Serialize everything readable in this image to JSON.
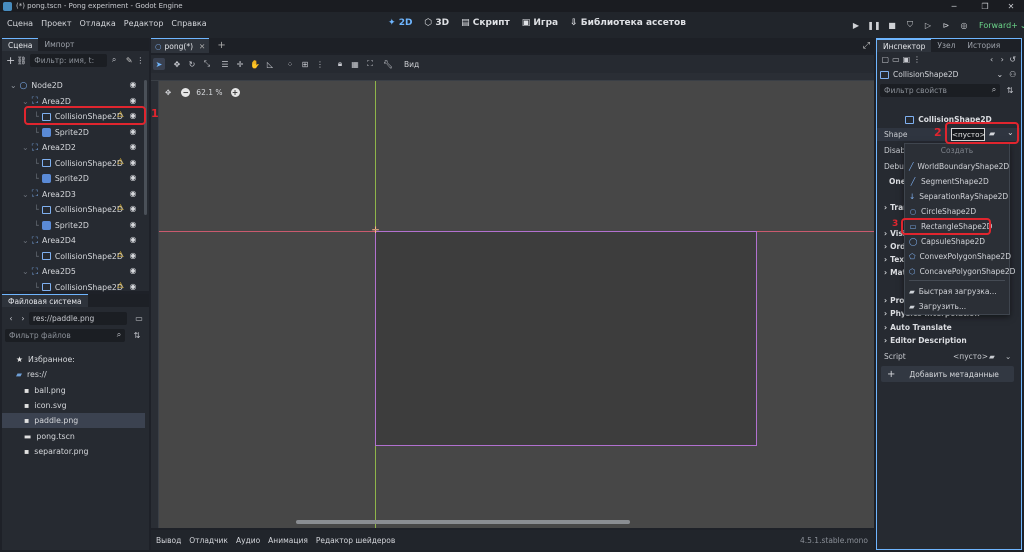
{
  "window": {
    "title": "(*) pong.tscn - Pong experiment - Godot Engine",
    "min": "─",
    "max": "❐",
    "close": "✕"
  },
  "menu": {
    "items": [
      "Сцена",
      "Проект",
      "Отладка",
      "Редактор",
      "Справка"
    ]
  },
  "modes": {
    "m2d": "2D",
    "m3d": "3D",
    "script": "Скрипт",
    "game": "Игра",
    "assetlib": "Библиотека ассетов"
  },
  "renderer": "Forward+",
  "scene_panel": {
    "tab_scene": "Сцена",
    "tab_import": "Импорт",
    "filter_placeholder": "Фильтр: имя, t:",
    "tree": [
      {
        "label": "Node2D",
        "type": "node2d",
        "indent": 0,
        "warn": false
      },
      {
        "label": "Area2D",
        "type": "area",
        "indent": 1,
        "warn": false
      },
      {
        "label": "CollisionShape2D",
        "type": "collision",
        "indent": 2,
        "warn": true
      },
      {
        "label": "Sprite2D",
        "type": "sprite",
        "indent": 2,
        "warn": false
      },
      {
        "label": "Area2D2",
        "type": "area",
        "indent": 1,
        "warn": false
      },
      {
        "label": "CollisionShape2D",
        "type": "collision",
        "indent": 2,
        "warn": true
      },
      {
        "label": "Sprite2D",
        "type": "sprite",
        "indent": 2,
        "warn": false
      },
      {
        "label": "Area2D3",
        "type": "area",
        "indent": 1,
        "warn": false
      },
      {
        "label": "CollisionShape2D",
        "type": "collision",
        "indent": 2,
        "warn": true
      },
      {
        "label": "Sprite2D",
        "type": "sprite",
        "indent": 2,
        "warn": false
      },
      {
        "label": "Area2D4",
        "type": "area",
        "indent": 1,
        "warn": false
      },
      {
        "label": "CollisionShape2D",
        "type": "collision",
        "indent": 2,
        "warn": true
      },
      {
        "label": "Area2D5",
        "type": "area",
        "indent": 1,
        "warn": false
      },
      {
        "label": "CollisionShape2D",
        "type": "collision",
        "indent": 2,
        "warn": true
      }
    ]
  },
  "filesystem": {
    "tab": "Файловая система",
    "path": "res://paddle.png",
    "filter_placeholder": "Фильтр файлов",
    "items": [
      {
        "label": "Избранное:",
        "icon": "star",
        "indent": 0
      },
      {
        "label": "res://",
        "icon": "folder",
        "indent": 0
      },
      {
        "label": "ball.png",
        "icon": "image",
        "indent": 1
      },
      {
        "label": "icon.svg",
        "icon": "image",
        "indent": 1
      },
      {
        "label": "paddle.png",
        "icon": "image",
        "indent": 1
      },
      {
        "label": "pong.tscn",
        "icon": "scene",
        "indent": 1
      },
      {
        "label": "separator.png",
        "icon": "image",
        "indent": 1
      }
    ]
  },
  "editor": {
    "tab": "pong(*)",
    "zoom": "62.1 %",
    "view_label": "Вид"
  },
  "bottom": {
    "tabs": [
      "Вывод",
      "Отладчик",
      "Аудио",
      "Анимация",
      "Редактор шейдеров"
    ],
    "version": "4.5.1.stable.mono"
  },
  "inspector": {
    "tabs": [
      "Инспектор",
      "Узел",
      "История"
    ],
    "object": "CollisionShape2D",
    "filter_placeholder": "Фильтр свойств",
    "header": "CollisionShape2D",
    "props": {
      "shape_label": "Shape",
      "shape_value": "<пусто>",
      "disabled_label": "Disab",
      "debug_label": "Debu",
      "oneway_label": "One",
      "transform": "Tran",
      "visibility": "Visi",
      "ordering": "Orde",
      "texture": "Text",
      "material": "Mat",
      "process": "Proc",
      "physics": "Physics Interpolation",
      "auto_translate": "Auto Translate",
      "editor_description": "Editor Description",
      "script_label": "Script",
      "script_value": "<пусто>",
      "add_metadata": "Добавить метаданные"
    },
    "dropdown": {
      "header": "Создать",
      "options": [
        "WorldBoundaryShape2D",
        "SegmentShape2D",
        "SeparationRayShape2D",
        "CircleShape2D",
        "RectangleShape2D",
        "CapsuleShape2D",
        "ConvexPolygonShape2D",
        "ConcavePolygonShape2D"
      ],
      "quick_load": "Быстрая загрузка...",
      "load": "Загрузить..."
    }
  },
  "annotations": {
    "n1": "1",
    "n2": "2",
    "n3": "3"
  },
  "colors": {
    "accent": "#6fb6ff",
    "warning": "#f2c33a",
    "annotation": "#e0252e",
    "viewport": "#474747"
  }
}
